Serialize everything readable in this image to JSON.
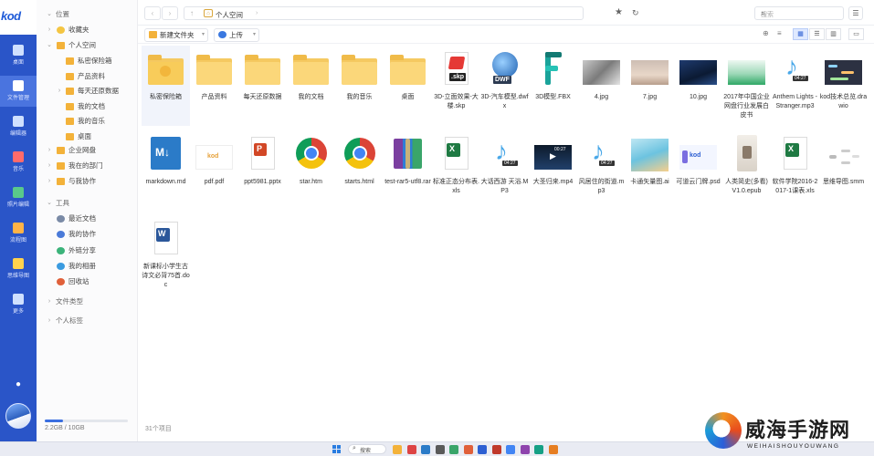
{
  "brand": "kod",
  "rail": [
    {
      "label": "桌面",
      "color": "#cfe0ff"
    },
    {
      "label": "文件管理",
      "color": "#ffffff",
      "active": true
    },
    {
      "label": "编辑器",
      "color": "#cfe0ff"
    },
    {
      "label": "音乐",
      "color": "#ff6b6b"
    },
    {
      "label": "照片编辑",
      "color": "#59c98a"
    },
    {
      "label": "流程图",
      "color": "#ffb347"
    },
    {
      "label": "思维导图",
      "color": "#ffd24d"
    },
    {
      "label": "更多",
      "color": "#cfe0ff"
    }
  ],
  "tree": {
    "location_header": "位置",
    "favorites": "收藏夹",
    "personal_space": "个人空间",
    "personal_children": [
      "私密保险箱",
      "产品资料",
      "每天还原数据",
      "我的文档",
      "我的音乐",
      "桌面"
    ],
    "enterprise_disk": "企业网盘",
    "my_department": "我在的部门",
    "my_collab": "与我协作",
    "tools_header": "工具",
    "tools": [
      "最近文档",
      "我的协作",
      "外链分享",
      "我的相册",
      "回收站"
    ],
    "file_types": "文件类型",
    "personal_tags": "个人标签"
  },
  "quota": {
    "text": "2.2GB / 10GB",
    "used_fraction": 0.22
  },
  "address": {
    "crumb": "个人空间"
  },
  "search": {
    "placeholder": "搜索"
  },
  "toolbar": {
    "new_folder": "新建文件夹",
    "upload": "上传"
  },
  "files": [
    {
      "name": "私密保险箱",
      "type": "safe"
    },
    {
      "name": "产品资料",
      "type": "folder"
    },
    {
      "name": "每天还原数据",
      "type": "folder"
    },
    {
      "name": "我的文档",
      "type": "folder"
    },
    {
      "name": "我的音乐",
      "type": "folder"
    },
    {
      "name": "桌面",
      "type": "folder"
    },
    {
      "name": "3D-立面效果-大楼.skp",
      "type": "skp"
    },
    {
      "name": "3D-汽车模型.dwfx",
      "type": "dwf"
    },
    {
      "name": "3D模型.FBX",
      "type": "fbx"
    },
    {
      "name": "4.jpg",
      "type": "img-cat"
    },
    {
      "name": "7.jpg",
      "type": "img-sand"
    },
    {
      "name": "10.jpg",
      "type": "img-dark"
    },
    {
      "name": "2017年中国企业网盘行业发展白皮书",
      "type": "img-chart"
    },
    {
      "name": "Anthem Lights - Stranger.mp3",
      "type": "mp3"
    },
    {
      "name": "kod技术总览.drawio",
      "type": "drawio"
    },
    {
      "name": "markdown.md",
      "type": "md"
    },
    {
      "name": "pdf.pdf",
      "type": "pdf"
    },
    {
      "name": "ppt5981.pptx",
      "type": "pptx"
    },
    {
      "name": "star.htm",
      "type": "chrome"
    },
    {
      "name": "starts.html",
      "type": "chrome"
    },
    {
      "name": "test-rar5-utf8.rar",
      "type": "rar"
    },
    {
      "name": "标准正态分布表.xls",
      "type": "xls"
    },
    {
      "name": "大话西游 天浴.MP3",
      "type": "mp3"
    },
    {
      "name": "大圣归来.mp4",
      "type": "mp4"
    },
    {
      "name": "风居住的街道.mp3",
      "type": "mp3"
    },
    {
      "name": "卡通矢量图.ai",
      "type": "ai"
    },
    {
      "name": "可道云门牌.psd",
      "type": "psd"
    },
    {
      "name": "人类简史(多看) V1.0.epub",
      "type": "epub"
    },
    {
      "name": "软件学院2016-2017-1课表.xls",
      "type": "xls"
    },
    {
      "name": "思维导图.smm",
      "type": "smm"
    },
    {
      "name": "新课标小学生古诗文必背75首.doc",
      "type": "doc"
    }
  ],
  "badges": {
    "skp": ".skp",
    "dwf": "DWF",
    "md": "M↓",
    "note": "04:27",
    "video": "00:27",
    "pdf": "kod",
    "psd": "kod"
  },
  "item_count": "31个项目",
  "taskbar": {
    "search": "搜索"
  },
  "watermark": {
    "title": "威海手游网",
    "sub": "WEIHAISHOUYOUWANG"
  }
}
